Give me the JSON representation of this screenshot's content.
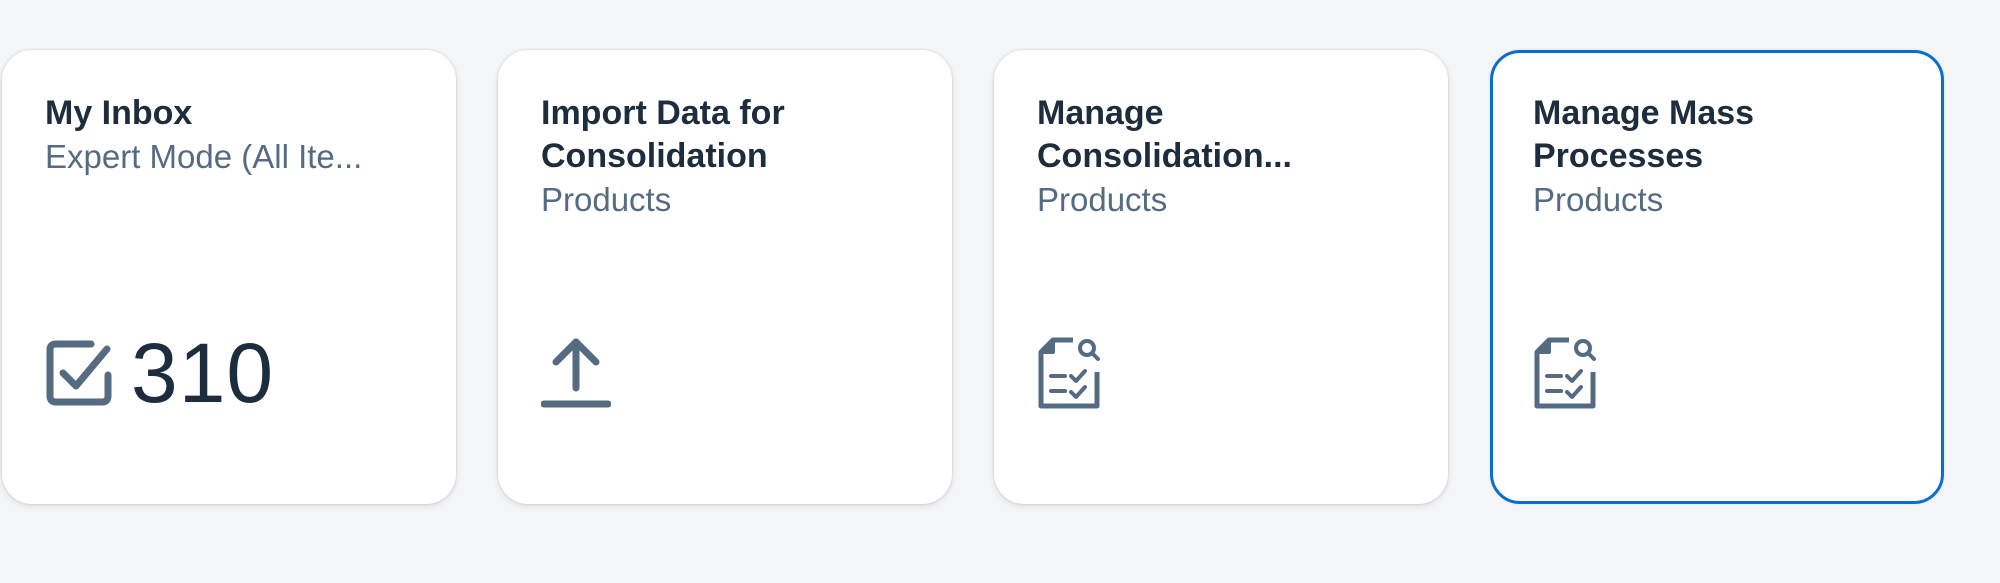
{
  "colors": {
    "background": "#f4f5f7",
    "tile_background": "#ffffff",
    "title": "#1d2d3e",
    "subtitle": "#556b82",
    "icon": "#556b82",
    "focus_border": "#0a6ed1"
  },
  "tiles": [
    {
      "title": "My Inbox",
      "subtitle": "Expert Mode (All Ite...",
      "icon": "task-checkbox-icon",
      "kpi_value": "310"
    },
    {
      "title_line1": "Import Data for",
      "title_line2": "Consolidation",
      "subtitle": "Products",
      "icon": "upload-icon"
    },
    {
      "title_line1": "Manage",
      "title_line2": "Consolidation...",
      "subtitle": "Products",
      "icon": "document-review-icon"
    },
    {
      "title_line1": "Manage Mass",
      "title_line2": "Processes",
      "subtitle": "Products",
      "icon": "document-review-icon",
      "focused": true
    }
  ]
}
